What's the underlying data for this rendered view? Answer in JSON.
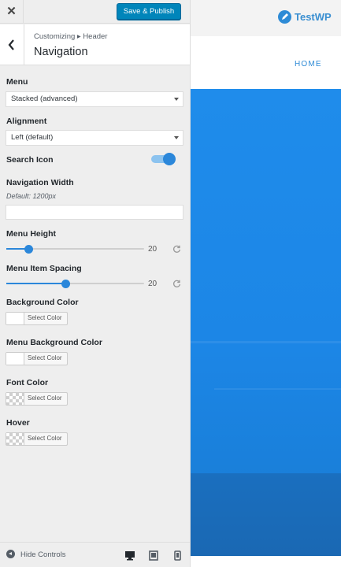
{
  "topbar": {
    "close_label": "✕",
    "publish_label": "Save & Publish"
  },
  "section": {
    "breadcrumb": "Customizing ▸ Header",
    "title": "Navigation"
  },
  "controls": {
    "menu": {
      "label": "Menu",
      "value": "Stacked (advanced)"
    },
    "alignment": {
      "label": "Alignment",
      "value": "Left (default)"
    },
    "search_icon": {
      "label": "Search Icon",
      "enabled": true
    },
    "navigation_width": {
      "label": "Navigation Width",
      "description": "Default: 1200px",
      "value": ""
    },
    "menu_height": {
      "label": "Menu Height",
      "value": "20",
      "fraction": 0.16
    },
    "menu_item_spacing": {
      "label": "Menu Item Spacing",
      "value": "20",
      "fraction": 0.43
    },
    "background_color": {
      "label": "Background Color",
      "button": "Select Color"
    },
    "menu_background_color": {
      "label": "Menu Background Color",
      "button": "Select Color"
    },
    "font_color": {
      "label": "Font Color",
      "button": "Select Color"
    },
    "hover": {
      "label": "Hover",
      "button": "Select Color"
    }
  },
  "footer": {
    "hide_controls": "Hide Controls"
  },
  "preview": {
    "logo": "TestWP",
    "menu_item": "HOME"
  },
  "colors": {
    "accent": "#2b87da",
    "publish": "#0085ba",
    "hero": "#1f8ceb"
  }
}
